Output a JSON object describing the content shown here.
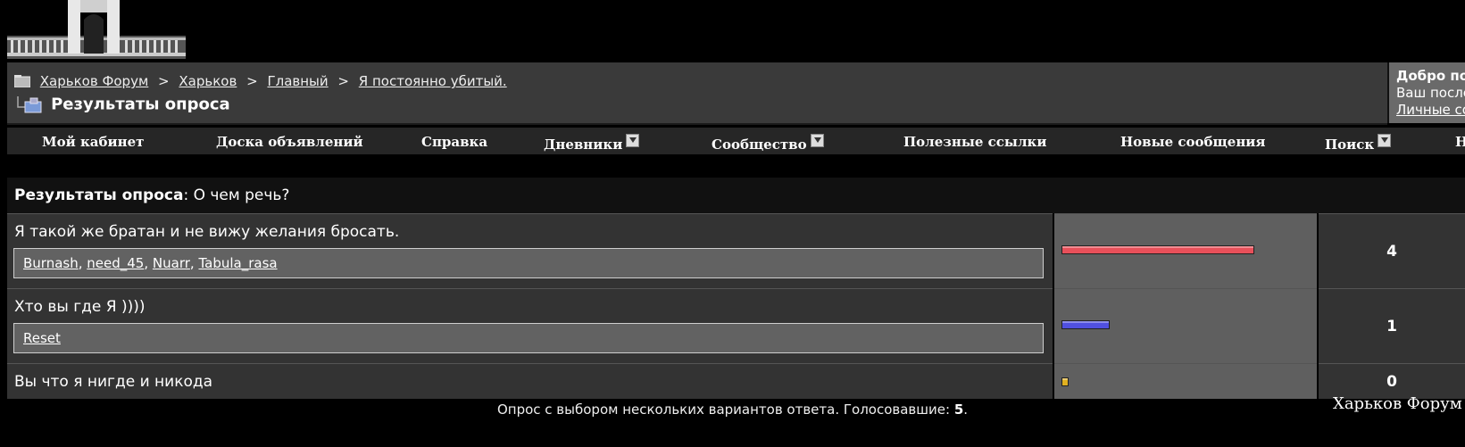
{
  "breadcrumb": {
    "items": [
      "Харьков Форум",
      "Харьков",
      "Главный",
      "Я постоянно убитый."
    ],
    "separator": ">",
    "page_title": "Результаты опроса"
  },
  "welcome": {
    "line1": "Добро пож",
    "line2": "Ваш после",
    "line3": "Личные со"
  },
  "menu": {
    "items": [
      "Мой кабинет",
      "Доска объявлений",
      "Справка",
      "Дневники",
      "Сообщество",
      "Полезные ссылки",
      "Новые сообщения",
      "Поиск",
      "Н"
    ]
  },
  "poll": {
    "label": "Результаты опроса",
    "question": "О чем речь?",
    "options": [
      {
        "text": "Я такой же братан и не вижу желания бросать.",
        "voters": [
          "Burnash",
          "need_45",
          "Nuarr",
          "Tabula_rasa"
        ],
        "votes": "4",
        "share": 0.8,
        "color": "#e8505a"
      },
      {
        "text": "Хто вы где Я ))))",
        "voters": [
          "Reset"
        ],
        "votes": "1",
        "share": 0.2,
        "color": "#5050e0"
      },
      {
        "text": "Вы что я нигде и никода",
        "voters": [],
        "votes": "0",
        "share": 0.0,
        "color": "#e0b020"
      }
    ],
    "footer_text": "Опрос с выбором нескольких вариантов ответа. Голосовавшие:",
    "total_voters": "5"
  },
  "brand": "Харьков Форум"
}
